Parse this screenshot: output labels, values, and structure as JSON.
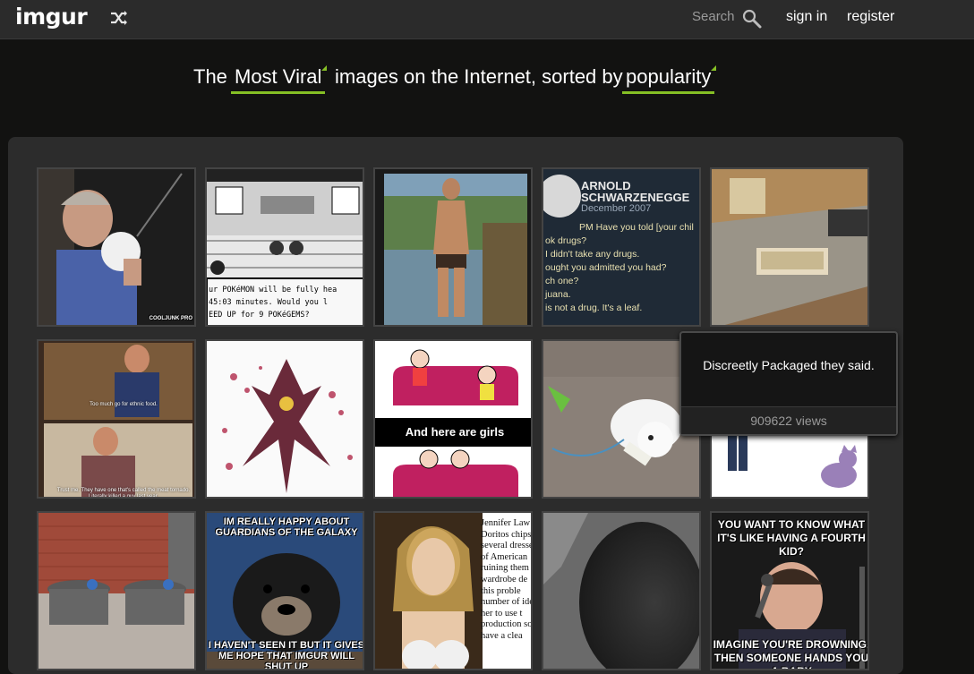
{
  "header": {
    "logo": "imgur",
    "shuffle_icon": "shuffle-icon",
    "search_placeholder": "Search",
    "search_icon": "search-icon",
    "sign_in": "sign in",
    "register": "register"
  },
  "headline": {
    "prefix": "The",
    "filter": "Most Viral",
    "middle": "images on the Internet, sorted by",
    "sort": "popularity",
    "accent_color": "#85bf25"
  },
  "gallery": {
    "tiles": [
      {
        "caption": "COOLJUNK PRO"
      },
      {
        "line1": "ur POKéMON will be fully hea",
        "line2": "45:03 minutes. Would you l",
        "line3": "EED UP for 9 POKéGEMS?"
      },
      {},
      {
        "name": "ARNOLD SCHWARZENEGGE",
        "date": "December 2007",
        "chat": [
          "PM Have you told [your chil",
          "ok drugs?",
          "I didn't take any drugs.",
          "ought you admitted you had?",
          "ch one?",
          "juana.",
          "is not a drug. It's a leaf."
        ]
      },
      {},
      {
        "sub1": "Too much go for ethnic food.",
        "sub2": "Trust me. They have one that's called the meat tornado. Literally killed a guy last year."
      },
      {},
      {
        "caption": "And here are girls"
      },
      {},
      {},
      {},
      {
        "top": "IM REALLY HAPPY ABOUT GUARDIANS OF THE GALAXY",
        "bottom": "I HAVEN'T SEEN IT BUT IT GIVES ME HOPE THAT IMGUR WILL SHUT UP"
      },
      {
        "lines": [
          "Jennifer Law",
          "Doritos chips o",
          "several dresse",
          "of American",
          "ruining them i",
          "wardrobe de",
          "this proble",
          "number of ide",
          "her to use t",
          "production so",
          "have a clea"
        ]
      },
      {},
      {
        "top": "YOU WANT TO KNOW WHAT IT'S LIKE HAVING A FOURTH KID?",
        "bottom": "IMAGINE YOU'RE DROWNING. THEN SOMEONE HANDS YOU A BABY"
      }
    ]
  },
  "tooltip": {
    "title": "Discreetly Packaged they said.",
    "views": "909622 views"
  }
}
